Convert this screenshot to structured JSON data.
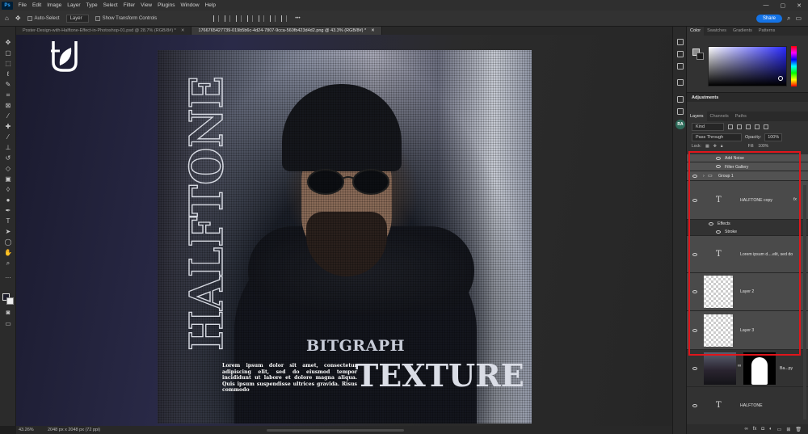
{
  "menubar": {
    "logo": "Ps",
    "items": [
      "File",
      "Edit",
      "Image",
      "Layer",
      "Type",
      "Select",
      "Filter",
      "View",
      "Plugins",
      "Window",
      "Help"
    ],
    "controls": [
      "—",
      "▢",
      "✕"
    ]
  },
  "options": {
    "auto_select_label": "Auto-Select",
    "layer_select": "Layer",
    "transform_label": "Show Transform Controls",
    "more": "•••",
    "share_label": "Share"
  },
  "tabs": [
    {
      "label": "Poster-Design-with-Halftone-Effect-in-Photoshop-01.psd @ 28.7% (RGB/8#) *",
      "active": false
    },
    {
      "label": "1766765427739-019b5b6c-4d24-7807-9cca-560fb423d4d2.png @ 43.3% (RGB/8#) *",
      "active": true
    }
  ],
  "poster": {
    "vertical_title": "HALFTONE",
    "brand": "BITGRAPH",
    "body": "Lorem ipsum dolor sit amet, consectetur adipiscing elit, sed do eiusmod tempor incididunt ut labore et dolore magna aliqua. Quis ipsum suspendisse ultrices gravida. Risus commodo",
    "word": "TEXTURE"
  },
  "status": {
    "zoom": "43.26%",
    "doc_size": "2048 px x 2048 px (72 ppi)"
  },
  "strip": {
    "ra_badge": "RA"
  },
  "color_panel": {
    "tabs": [
      "Color",
      "Swatches",
      "Gradients",
      "Patterns"
    ]
  },
  "adjustments": {
    "title": "Adjustments"
  },
  "layers_panel": {
    "tabs": [
      "Layers",
      "Channels",
      "Paths"
    ],
    "kind_label": "Kind",
    "blend_mode": "Pass Through",
    "opacity_label": "Opacity:",
    "opacity_value": "100%",
    "lock_label": "Lock:",
    "fill_label": "Fill:",
    "fill_value": "100%",
    "layers": [
      {
        "name": "Add Noise",
        "type": "filter"
      },
      {
        "name": "Filter Gallery",
        "type": "filter"
      },
      {
        "name": "Group 1",
        "type": "group"
      },
      {
        "name": "HALFTONE copy",
        "type": "text",
        "fx": "fx"
      },
      {
        "name": "Effects",
        "type": "effects"
      },
      {
        "name": "Stroke",
        "type": "effect"
      },
      {
        "name": "Lorem ipsum d....elit, sed do",
        "type": "text"
      },
      {
        "name": "Layer 2",
        "type": "pixel"
      },
      {
        "name": "Layer 3",
        "type": "pixel"
      },
      {
        "name": "Ba...py",
        "type": "photo"
      },
      {
        "name": "HALFTONE",
        "type": "text"
      }
    ]
  },
  "colors": {
    "accent_blue": "#1473e6",
    "highlight_red": "#e0151b",
    "panel_bg": "#323232"
  }
}
